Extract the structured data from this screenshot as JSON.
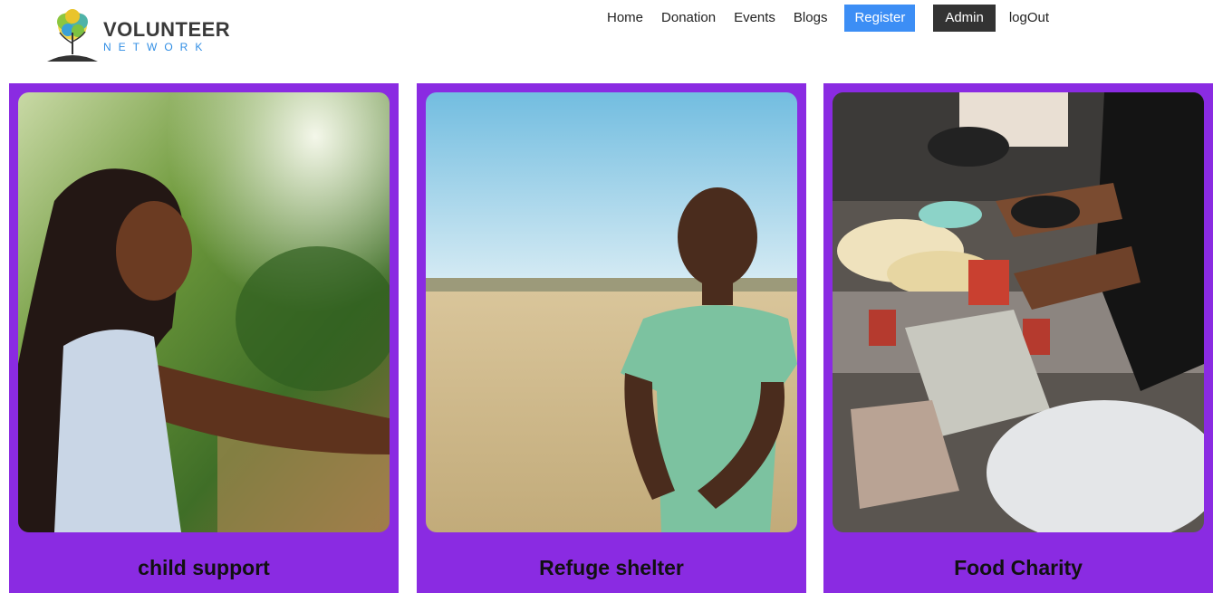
{
  "brand": {
    "title": "VOLUNTEER",
    "subtitle": "NETWORK"
  },
  "nav": {
    "home": "Home",
    "donation": "Donation",
    "events": "Events",
    "blogs": "Blogs",
    "register": "Register",
    "admin": "Admin",
    "logout": "logOut"
  },
  "cards": [
    {
      "title": "child support",
      "image": "girl-smiling-outdoors-photo"
    },
    {
      "title": "Refuge shelter",
      "image": "boy-standing-in-field-photo"
    },
    {
      "title": "Food Charity",
      "image": "food-donation-volunteers-photo"
    }
  ],
  "colors": {
    "card_bg": "#8a2be2",
    "register_bg": "#3c8ef5",
    "admin_bg": "#333333",
    "brand_sub": "#2f8de4"
  }
}
